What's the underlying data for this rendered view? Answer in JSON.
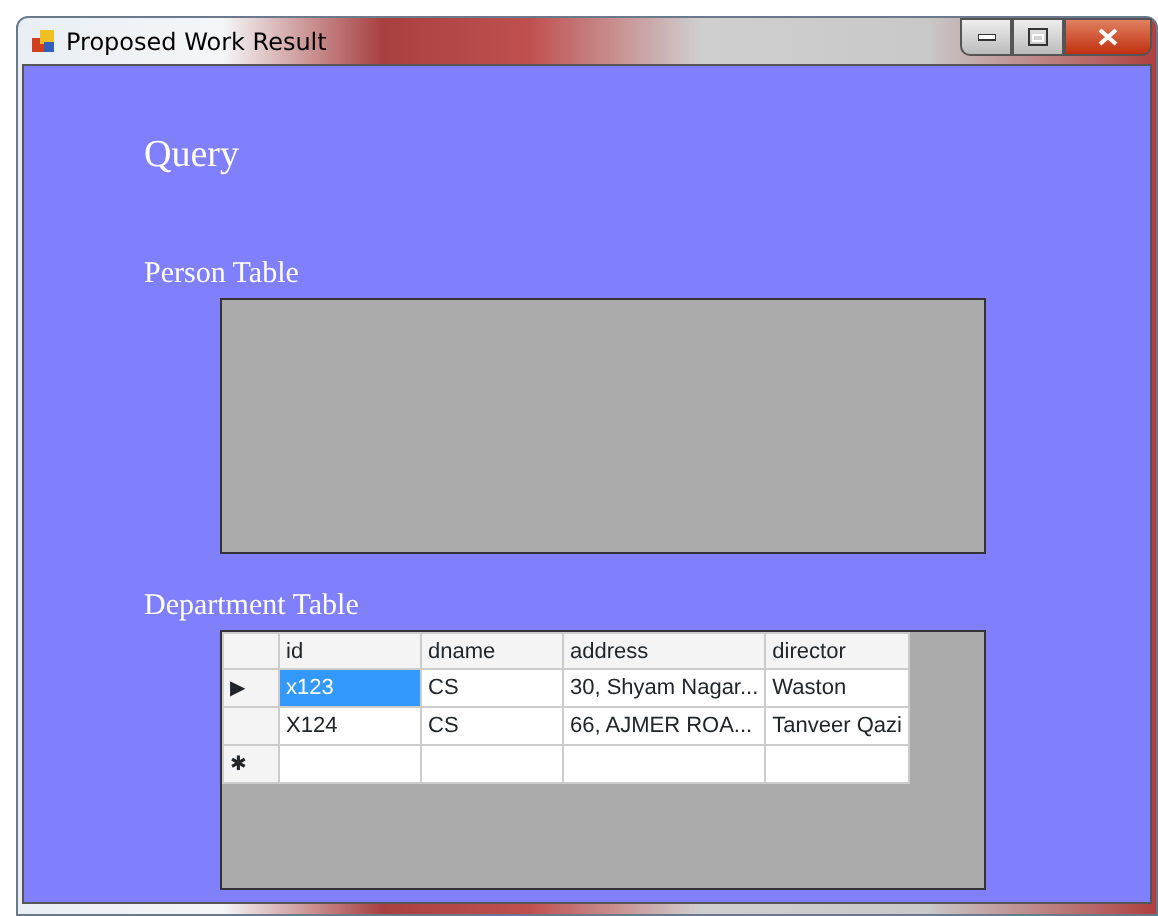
{
  "window": {
    "title": "Proposed Work Result"
  },
  "heading": "Query",
  "person_table": {
    "label": "Person Table"
  },
  "department_table": {
    "label": "Department Table",
    "columns": [
      "id",
      "dname",
      "address",
      "director"
    ],
    "rows": [
      {
        "marker": "▶",
        "cells": [
          {
            "text": "x123",
            "selected": true
          },
          {
            "text": "CS",
            "selected": false
          },
          {
            "text": "30, Shyam Nagar...",
            "selected": false
          },
          {
            "text": "Waston",
            "selected": false
          }
        ]
      },
      {
        "marker": "",
        "cells": [
          {
            "text": "X124",
            "selected": false
          },
          {
            "text": "CS",
            "selected": false
          },
          {
            "text": "66, AJMER ROA...",
            "selected": false
          },
          {
            "text": "Tanveer Qazi",
            "selected": false
          }
        ]
      },
      {
        "marker": "✱",
        "cells": [
          {
            "text": "",
            "selected": false
          },
          {
            "text": "",
            "selected": false
          },
          {
            "text": "",
            "selected": false
          },
          {
            "text": "",
            "selected": false
          }
        ]
      }
    ]
  }
}
